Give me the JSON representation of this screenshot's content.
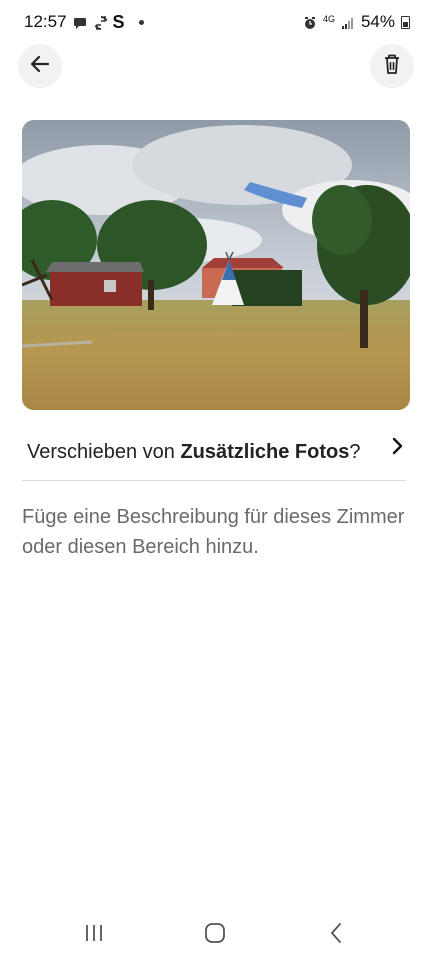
{
  "status_bar": {
    "time": "12:57",
    "network": "4G",
    "battery": "54%",
    "icons": [
      "chat-bubble-icon",
      "sync-icon",
      "s-app-icon",
      "notification-dot",
      "alarm-icon",
      "signal-icon",
      "battery-icon"
    ],
    "s_letter": "S"
  },
  "header": {
    "back_icon": "arrow-left-icon",
    "delete_icon": "trash-icon"
  },
  "photo": {
    "alt": "Wiese mit Bäumen, roter Scheune und Tipi-Zelt"
  },
  "move": {
    "prefix": "Verschieben von ",
    "target": "Zusätzliche Fotos",
    "suffix": "?"
  },
  "description": {
    "placeholder": "Füge eine Beschreibung für dieses Zimmer oder diesen Bereich hinzu."
  },
  "nav": {
    "recents_icon": "recent-apps-icon",
    "home_icon": "home-icon",
    "back_icon": "back-chevron-icon"
  }
}
